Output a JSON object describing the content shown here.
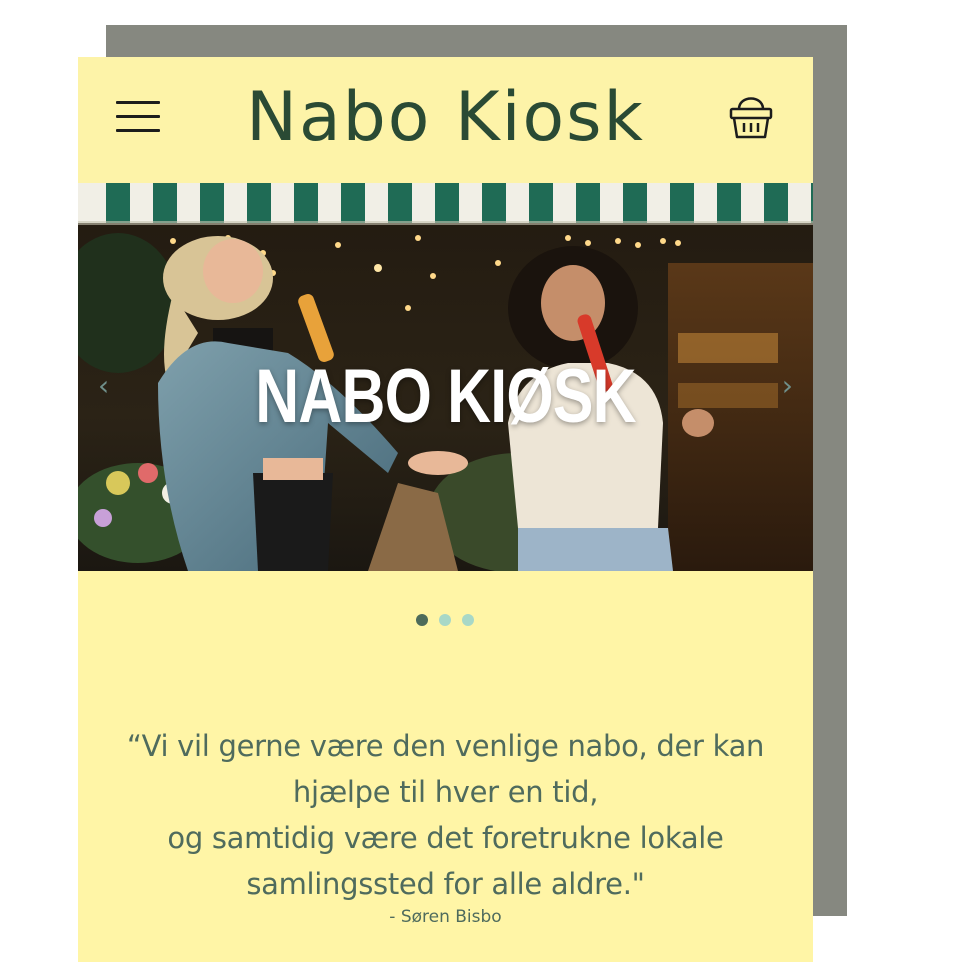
{
  "brand": {
    "name": "Nabo Kiosk"
  },
  "header": {
    "menu_icon": "hamburger-menu-icon",
    "cart_icon": "basket-icon"
  },
  "hero": {
    "title": "NABO KIØSK",
    "prev_arrow": "‹",
    "next_arrow": "›",
    "slides_total": 3,
    "active_slide": 1
  },
  "quote": {
    "line1": "“Vi vil gerne være den venlige nabo, der kan",
    "line2": "hjælpe til hver en tid,",
    "line3": "og samtidig være det foretrukne lokale",
    "line4": "samlingssted for alle aldre.\"",
    "author": "- Søren Bisbo"
  },
  "colors": {
    "background": "#fff5a6",
    "logo": "#2a4a34",
    "quote_text": "#4f6b5d",
    "dot_active": "#4d6b5a",
    "dot_inactive": "#a8d8c7",
    "awning_green": "#1f6b55",
    "awning_white": "#f1efe6",
    "backdrop": "#868880"
  }
}
